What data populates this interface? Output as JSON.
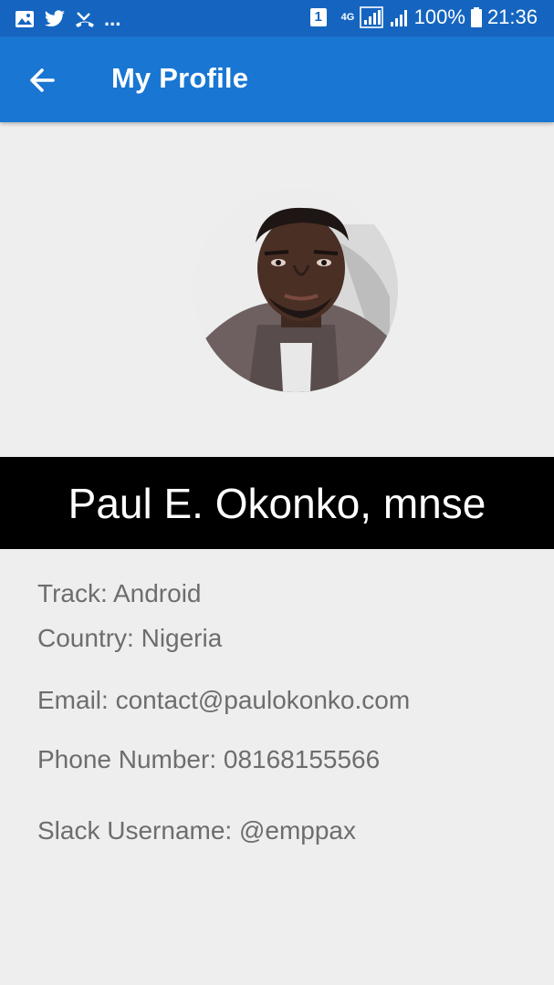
{
  "status_bar": {
    "sim_badge": "1",
    "network": "4G",
    "battery": "100%",
    "time": "21:36",
    "more": "...",
    "icons": [
      "image-icon",
      "twitter-icon",
      "missed-call-icon",
      "sim-icon",
      "signal-icon",
      "battery-icon"
    ]
  },
  "app_bar": {
    "title": "My Profile",
    "back_icon": "arrow-left-icon",
    "color": "#1976d2"
  },
  "profile": {
    "name": "Paul E. Okonko, mnse",
    "track": "Track: Android",
    "country": "Country: Nigeria",
    "email": "Email: contact@paulokonko.com",
    "phone": "Phone Number: 08168155566",
    "slack": "Slack Username: @emppax"
  },
  "colors": {
    "status_bar": "#1565c0",
    "background": "#eeeeee",
    "name_band": "#000000",
    "info_text": "#6d6d6d"
  }
}
